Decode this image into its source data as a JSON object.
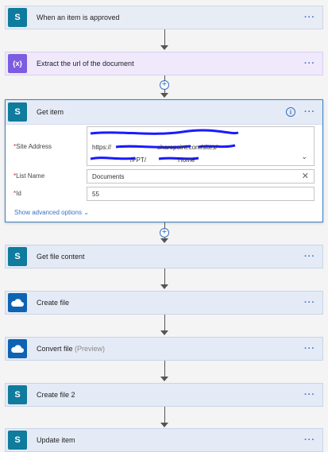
{
  "steps": {
    "approved": {
      "title": "When an item is approved",
      "icon": "sharepoint-icon"
    },
    "extract": {
      "title": "Extract the url of the document",
      "icon": "variable-icon"
    },
    "get_item": {
      "title": "Get item",
      "icon": "sharepoint-icon",
      "fields": {
        "site_address": {
          "label": "Site Address",
          "value_line2": "https://",
          "value_line2_b": "sharepoint.com/sites/",
          "value_line3": "/PPT/",
          "value_line3_b": "Home"
        },
        "list_name": {
          "label": "List Name",
          "value": "Documents"
        },
        "id": {
          "label": "Id",
          "value": "55"
        }
      },
      "advanced": "Show advanced options"
    },
    "get_file_content": {
      "title": "Get file content",
      "icon": "sharepoint-icon"
    },
    "create_file": {
      "title": "Create file",
      "icon": "onedrive-icon"
    },
    "convert_file": {
      "title": "Convert file",
      "tag": "(Preview)",
      "icon": "onedrive-icon"
    },
    "create_file_2": {
      "title": "Create file 2",
      "icon": "sharepoint-icon"
    },
    "update_item": {
      "title": "Update item",
      "icon": "sharepoint-icon"
    }
  },
  "glyphs": {
    "more": "···",
    "required": "*",
    "sp_letter": "S",
    "var_letter": "{x}",
    "info": "i",
    "clear": "✕",
    "chevron": "⌄",
    "plus": "+"
  },
  "colors": {
    "accent": "#3a6fc2",
    "sharepoint": "#0f7b9d",
    "onedrive": "#0e63b3",
    "variable": "#7c5ce0",
    "redaction": "#1a1aff"
  }
}
